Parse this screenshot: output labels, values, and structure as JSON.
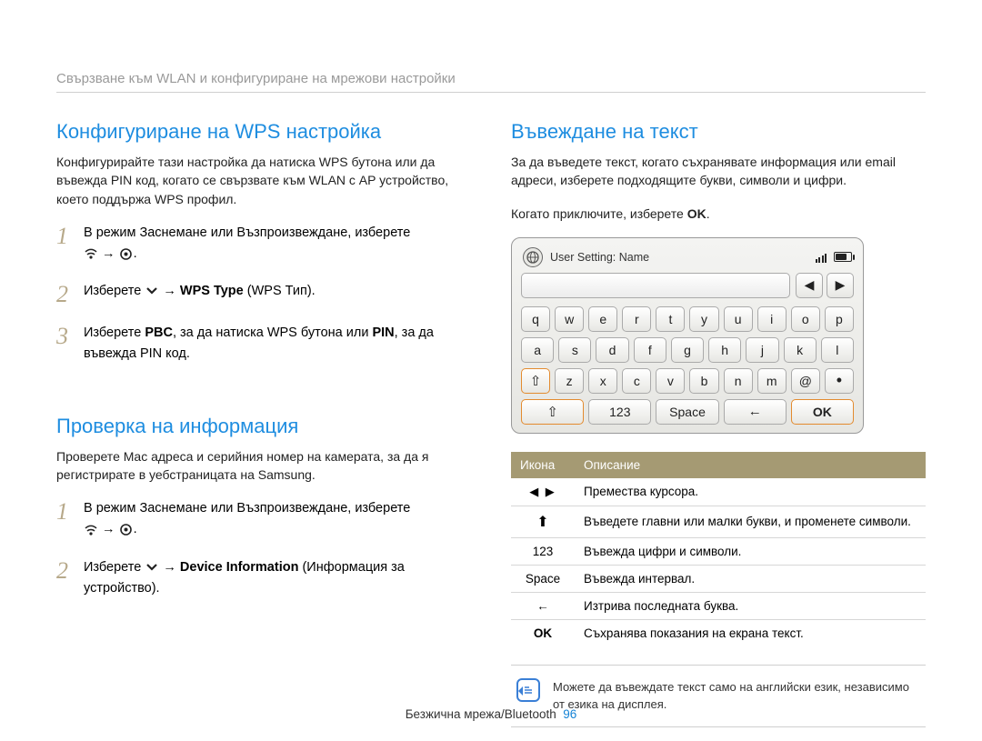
{
  "header": "Свързване към WLAN и конфигуриране на мрежови настройки",
  "left": {
    "sec1_title": "Конфигуриране на WPS настройка",
    "sec1_intro": "Конфигурирайте тази настройка да натиска WPS бутона или да въвежда PIN код, когато се свързвате към WLAN с AP устройство, което поддържа WPS профил.",
    "step1": "В режим Заснемане или Възпроизвеждане, изберете",
    "step2_a": "Изберете ",
    "step2_b": " → ",
    "step2_c": "WPS Type",
    "step2_d": " (WPS Тип).",
    "step3_a": "Изберете ",
    "step3_b": "PBC",
    "step3_c": ", за да натиска WPS бутона или ",
    "step3_d": "PIN",
    "step3_e": ", за да въвежда PIN код.",
    "sec2_title": "Проверка на информация",
    "sec2_intro": "Проверете Mac адреса и серийния номер на камерата, за да я регистрирате в уебстраницата на Samsung.",
    "s2_step1": "В режим Заснемане или Възпроизвеждане, изберете",
    "s2_step2_a": "Изберете ",
    "s2_step2_b": " → ",
    "s2_step2_c": "Device Information",
    "s2_step2_d": " (Информация за устройство)."
  },
  "right": {
    "title": "Въвеждане на текст",
    "intro": "За да въведете текст, когато съхранявате информация или email адреси, изберете подходящите букви, символи и цифри.",
    "intro2_a": "Когато приключите, изберете ",
    "intro2_b": "OK",
    "intro2_c": ".",
    "kb": {
      "status_label": "User Setting: Name",
      "row1": [
        "q",
        "w",
        "e",
        "r",
        "t",
        "y",
        "u",
        "i",
        "o",
        "p"
      ],
      "row2": [
        "a",
        "s",
        "d",
        "f",
        "g",
        "h",
        "j",
        "k",
        "l"
      ],
      "row3": [
        "z",
        "x",
        "c",
        "v",
        "b",
        "n",
        "m",
        "@"
      ],
      "mode_key": "123",
      "space_key": "Space",
      "ok_key": "OK"
    },
    "table": {
      "h1": "Икона",
      "h2": "Описание",
      "r1_icon": "◀ ▶",
      "r1": "Премества курсора.",
      "r2": "Въведете главни или малки букви, и променете символи.",
      "r3_icon": "123",
      "r3": "Въвежда цифри и символи.",
      "r4_icon": "Space",
      "r4": "Въвежда интервал.",
      "r5": "Изтрива последната буква.",
      "r6_icon": "OK",
      "r6": "Съхранява показания на екрана текст."
    },
    "note": "Можете да въвеждате текст само на английски език, независимо от езика на дисплея."
  },
  "footer": {
    "text": "Безжична мрежа/Bluetooth",
    "page": "96"
  }
}
